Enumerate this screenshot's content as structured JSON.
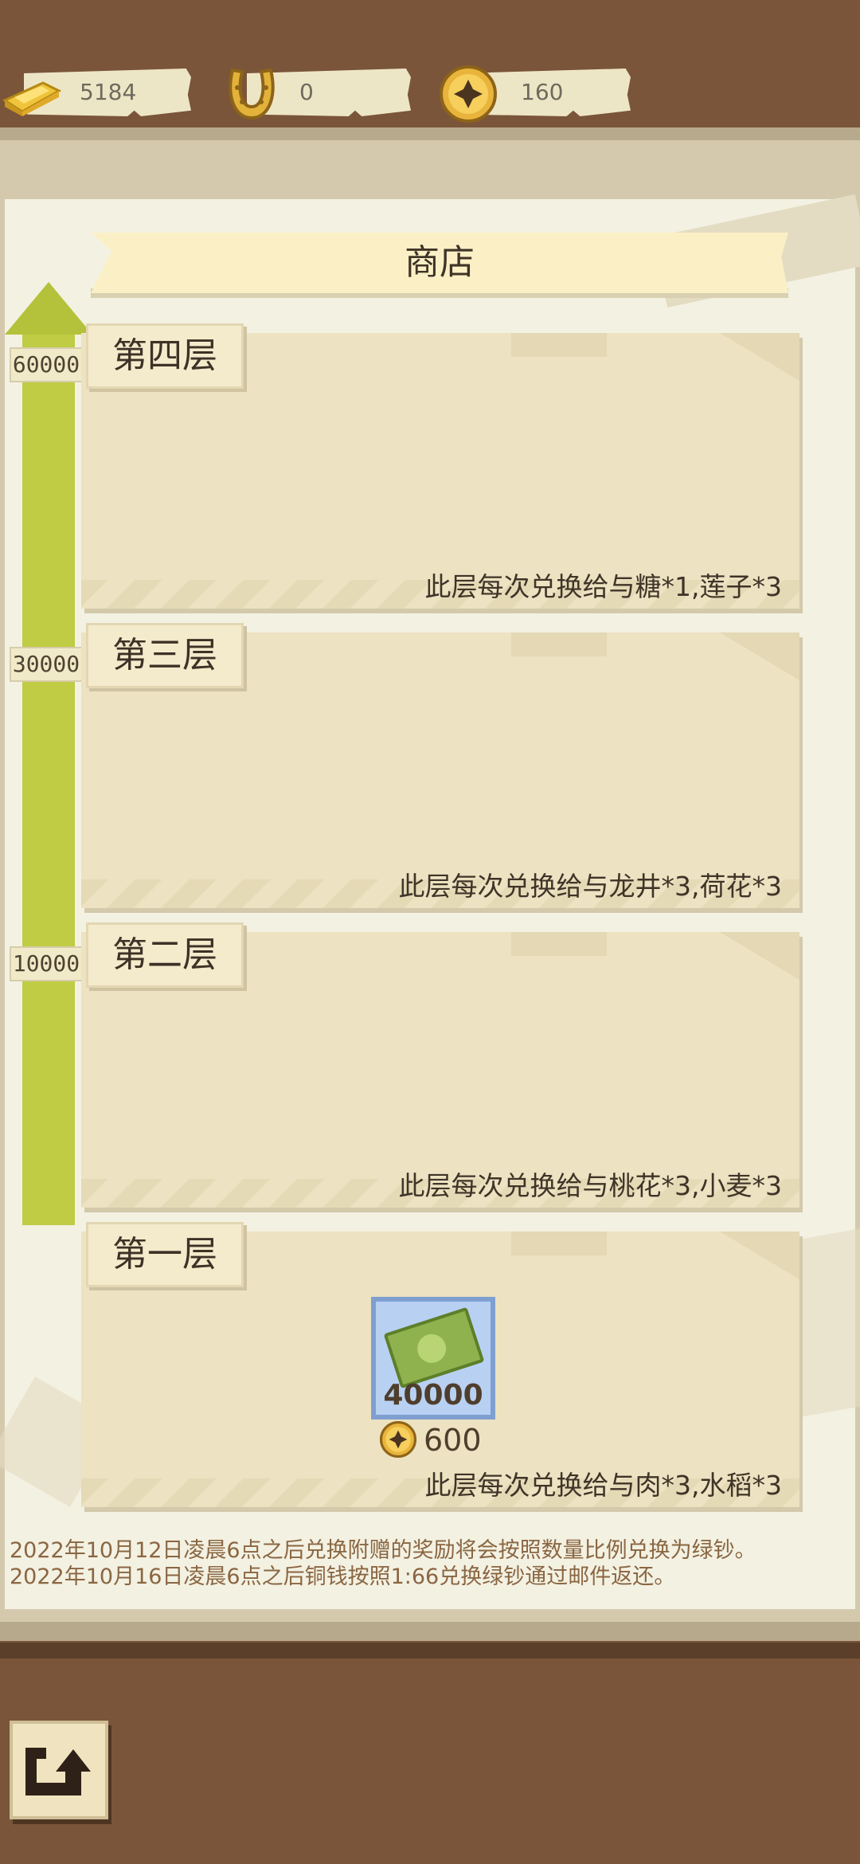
{
  "resources": [
    {
      "icon": "gold-bar-icon",
      "value": "5184"
    },
    {
      "icon": "horseshoe-icon",
      "value": "0"
    },
    {
      "icon": "copper-coin-icon",
      "value": "160"
    }
  ],
  "shop": {
    "title": "商店"
  },
  "milestones": [
    "60000",
    "30000",
    "10000"
  ],
  "tiers": [
    {
      "label": "第四层",
      "description": "此层每次兑换给与糖*1,莲子*3"
    },
    {
      "label": "第三层",
      "description": "此层每次兑换给与龙井*3,荷花*3"
    },
    {
      "label": "第二层",
      "description": "此层每次兑换给与桃花*3,小麦*3"
    },
    {
      "label": "第一层",
      "description": "此层每次兑换给与肉*3,水稻*3"
    }
  ],
  "reward_item": {
    "icon": "green-cash-icon",
    "count": "40000",
    "cost_icon": "copper-coin-icon",
    "cost": "600"
  },
  "notices": [
    "2022年10月12日凌晨6点之后兑换附赠的奖励将会按照数量比例兑换为绿钞。",
    "2022年10月16日凌晨6点之后铜钱按照1:66兑换绿钞通过邮件返还。"
  ],
  "colors": {
    "background": "#7a553a",
    "panel": "#f3f1e2",
    "card": "#ede2c1",
    "progress": "#bfcc44",
    "notice_text": "#8a6642"
  },
  "back_button": {
    "icon": "back-arrow-icon"
  }
}
